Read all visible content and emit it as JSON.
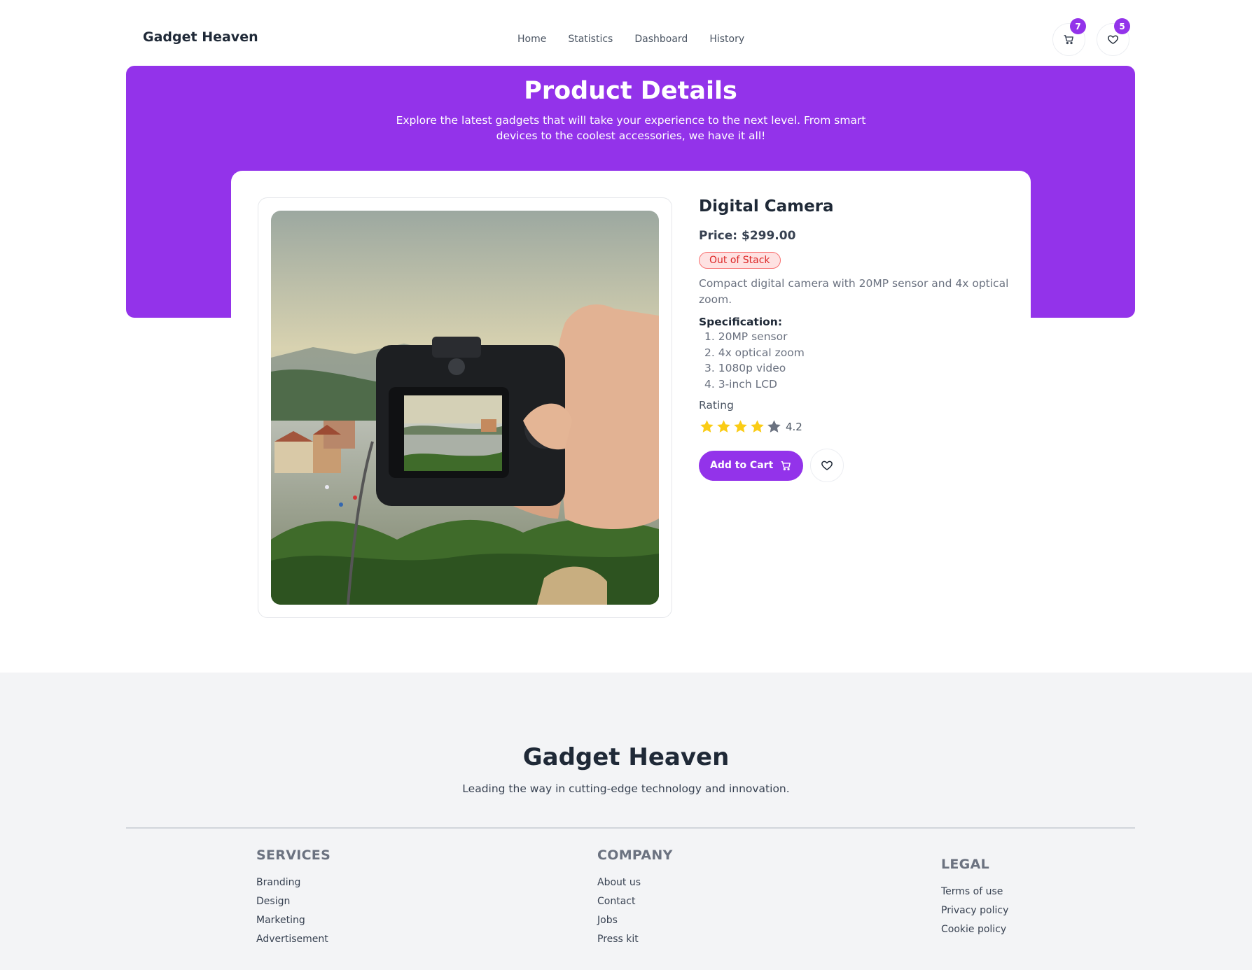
{
  "nav": {
    "logo": "Gadget Heaven",
    "links": [
      "Home",
      "Statistics",
      "Dashboard",
      "History"
    ],
    "cart_count": "7",
    "wishlist_count": "5"
  },
  "hero": {
    "title": "Product Details",
    "subtitle": "Explore the latest gadgets that will take your experience to the next level. From smart devices to the coolest accessories, we have it all!"
  },
  "product": {
    "name": "Digital Camera",
    "price": "Price: $299.00",
    "stock_status": "Out of Stack",
    "description": "Compact digital camera with 20MP sensor and 4x optical zoom.",
    "spec_heading": "Specification:",
    "specs": [
      "1. 20MP sensor",
      "2. 4x optical zoom",
      "3. 1080p video",
      "4. 3-inch LCD"
    ],
    "rating_label": "Rating",
    "rating_value": "4.2",
    "stars_filled": 4,
    "stars_total": 5,
    "add_to_cart_label": "Add to Cart"
  },
  "footer": {
    "title": "Gadget Heaven",
    "tagline": "Leading the way in cutting-edge technology and innovation.",
    "columns": [
      {
        "heading": "SERVICES",
        "links": [
          "Branding",
          "Design",
          "Marketing",
          "Advertisement"
        ]
      },
      {
        "heading": "COMPANY",
        "links": [
          "About us",
          "Contact",
          "Jobs",
          "Press kit"
        ]
      },
      {
        "heading": "LEGAL",
        "links": [
          "Terms of use",
          "Privacy policy",
          "Cookie policy"
        ]
      }
    ]
  },
  "colors": {
    "accent": "#9333ea",
    "star_filled": "#facc15",
    "star_empty": "#6b7280",
    "stock_text": "#dc2626",
    "footer_bg": "#f3f4f6"
  }
}
